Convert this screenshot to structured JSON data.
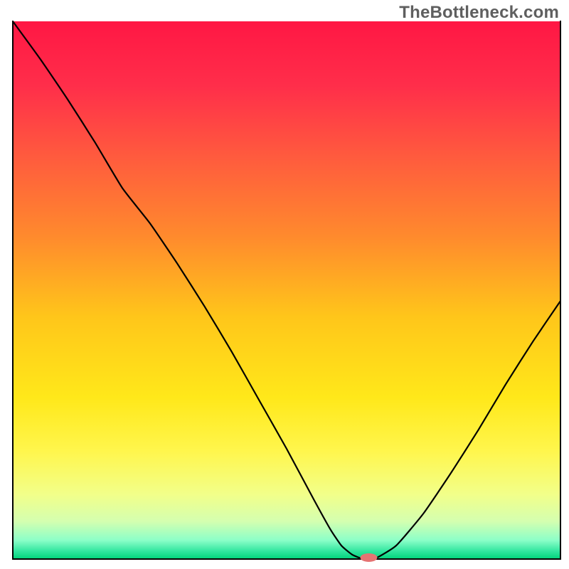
{
  "watermark": "TheBottleneck.com",
  "chart_data": {
    "type": "line",
    "title": "",
    "xlabel": "",
    "ylabel": "",
    "xlim": [
      0,
      100
    ],
    "ylim": [
      0,
      100
    ],
    "grid": false,
    "legend": false,
    "annotations": [],
    "background": {
      "type": "vertical-gradient",
      "stops": [
        {
          "pos": 0.0,
          "color": "#ff1744"
        },
        {
          "pos": 0.12,
          "color": "#ff2e4a"
        },
        {
          "pos": 0.25,
          "color": "#ff5a3e"
        },
        {
          "pos": 0.4,
          "color": "#ff8a2d"
        },
        {
          "pos": 0.55,
          "color": "#ffc61a"
        },
        {
          "pos": 0.7,
          "color": "#ffe81a"
        },
        {
          "pos": 0.8,
          "color": "#fff64d"
        },
        {
          "pos": 0.88,
          "color": "#f2ff8a"
        },
        {
          "pos": 0.93,
          "color": "#d4ffb0"
        },
        {
          "pos": 0.965,
          "color": "#8cffc8"
        },
        {
          "pos": 0.985,
          "color": "#33e6a0"
        },
        {
          "pos": 1.0,
          "color": "#00d27a"
        }
      ]
    },
    "axis_lines": {
      "left": true,
      "right": true,
      "top": false,
      "bottom": true,
      "color": "#000000",
      "width": 2
    },
    "series": [
      {
        "name": "bottleneck-curve",
        "color": "#000000",
        "width": 2.2,
        "x": [
          0.0,
          5.0,
          10.0,
          15.0,
          20.0,
          25.0,
          30.0,
          35.0,
          40.0,
          45.0,
          50.0,
          55.0,
          58.0,
          60.0,
          62.0,
          64.0,
          66.0,
          70.0,
          75.0,
          80.0,
          85.0,
          90.0,
          95.0,
          100.0
        ],
        "y": [
          100.0,
          93.0,
          85.5,
          77.5,
          69.0,
          62.5,
          55.0,
          47.0,
          38.5,
          29.5,
          20.5,
          11.0,
          5.5,
          2.5,
          0.8,
          0.0,
          0.0,
          2.5,
          8.5,
          16.0,
          24.0,
          32.5,
          40.5,
          48.0
        ]
      }
    ],
    "marker": {
      "name": "optimal-point",
      "x": 65.0,
      "y": 0.0,
      "color": "#e57373",
      "rx": 12,
      "ry": 6
    }
  }
}
